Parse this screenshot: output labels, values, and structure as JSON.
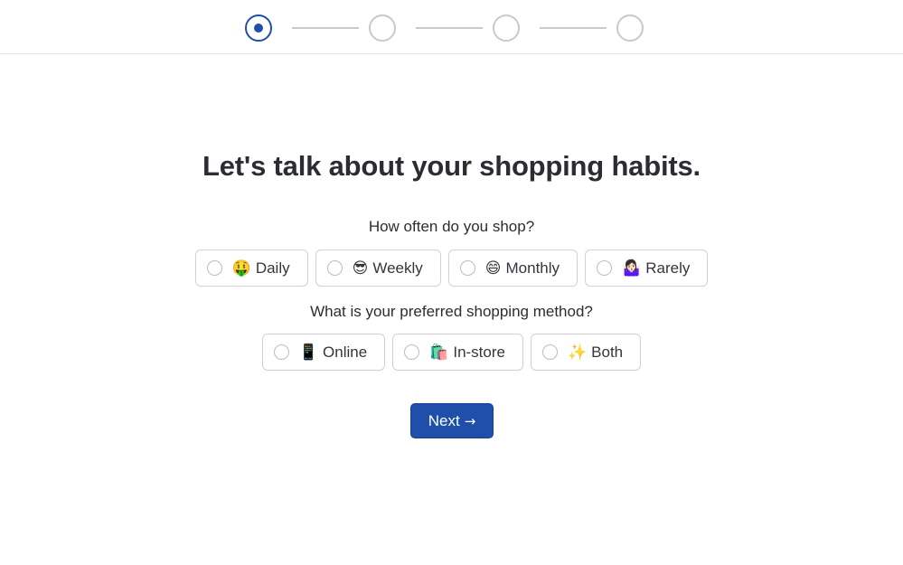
{
  "stepper": {
    "total_steps": 4,
    "current_step": 1
  },
  "page": {
    "title": "Let's talk about your shopping habits."
  },
  "questions": [
    {
      "label": "How often do you shop?",
      "options": [
        {
          "emoji": "🤑",
          "label": "Daily"
        },
        {
          "emoji": "😎",
          "label": "Weekly"
        },
        {
          "emoji": "😄",
          "label": "Monthly"
        },
        {
          "emoji": "🤷🏻‍♀️",
          "label": "Rarely"
        }
      ]
    },
    {
      "label": "What is your preferred shopping method?",
      "options": [
        {
          "emoji": "📱",
          "label": "Online"
        },
        {
          "emoji": "🛍️",
          "label": "In-store"
        },
        {
          "emoji": "✨",
          "label": "Both"
        }
      ]
    }
  ],
  "next_button": {
    "label": "Next",
    "icon": "→"
  },
  "colors": {
    "accent": "#1f4fa8",
    "border": "#cfd1d6",
    "text": "#2b2d33"
  }
}
